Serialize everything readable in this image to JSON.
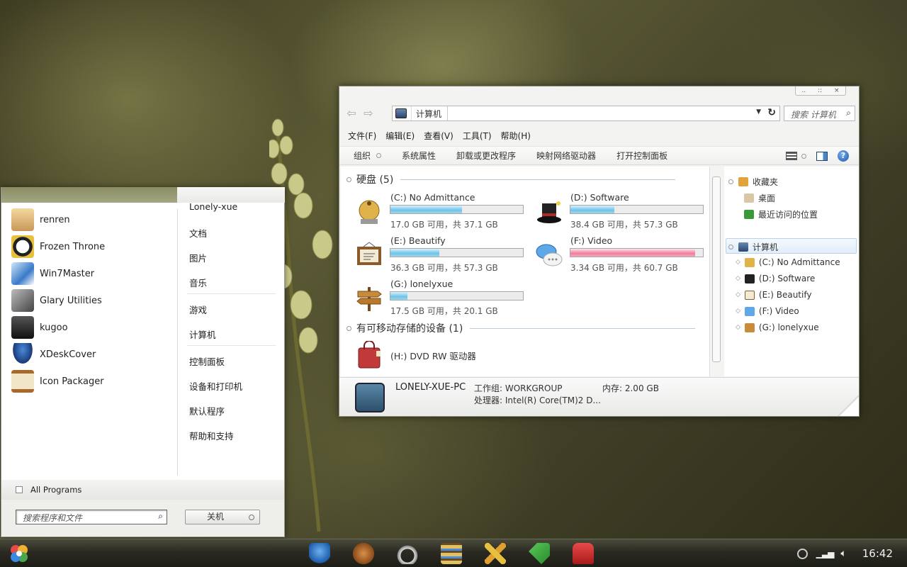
{
  "explorer": {
    "caption_buttons": [
      "..",
      "::",
      "×"
    ],
    "breadcrumb": "计算机",
    "search_placeholder": "搜索 计算机",
    "menu": [
      "文件(F)",
      "编辑(E)",
      "查看(V)",
      "工具(T)",
      "帮助(H)"
    ],
    "commands": [
      "组织",
      "系统属性",
      "卸载或更改程序",
      "映射网络驱动器",
      "打开控制面板"
    ],
    "groups": {
      "hard_disks": "硬盘 (5)",
      "removable": "有可移动存储的设备 (1)"
    },
    "drives": [
      {
        "name": "(C:) No Admittance",
        "free": "17.0 GB 可用，共 37.1 GB",
        "used_fraction": 0.54,
        "color": "#6ec3e8"
      },
      {
        "name": "(D:) Software",
        "free": "38.4 GB 可用，共 57.3 GB",
        "used_fraction": 0.33,
        "color": "#6ec3e8"
      },
      {
        "name": "(E:) Beautify",
        "free": "36.3 GB 可用，共 57.3 GB",
        "used_fraction": 0.37,
        "color": "#6ec3e8"
      },
      {
        "name": "(F:) Video",
        "free": "3.34 GB 可用，共 60.7 GB",
        "used_fraction": 0.94,
        "color": "#ee7f9d"
      },
      {
        "name": "(G:) lonelyxue",
        "free": "17.5 GB 可用，共 20.1 GB",
        "used_fraction": 0.13,
        "color": "#6ec3e8"
      }
    ],
    "dvd": "(H:) DVD RW 驱动器",
    "nav": {
      "favorites": "收藏夹",
      "desktop": "桌面",
      "recent": "最近访问的位置",
      "computer": "计算机",
      "drives": [
        "(C:) No Admittance",
        "(D:) Software",
        "(E:) Beautify",
        "(F:) Video",
        "(G:) lonelyxue"
      ]
    },
    "details": {
      "pc_name": "LONELY-XUE-PC",
      "workgroup": "工作组: WORKGROUP",
      "memory": "内存: 2.00 GB",
      "cpu": "处理器: Intel(R) Core(TM)2 D..."
    }
  },
  "start_menu": {
    "programs": [
      "renren",
      "Frozen Throne",
      "Win7Master",
      "Glary Utilities",
      "kugoo",
      "XDeskCover",
      "Icon Packager"
    ],
    "places": [
      "Lonely-xue",
      "文档",
      "图片",
      "音乐",
      "游戏",
      "计算机",
      "控制面板",
      "设备和打印机",
      "默认程序",
      "帮助和支持"
    ],
    "all_programs": "All Programs",
    "search_placeholder": "搜索程序和文件",
    "shutdown": "关机"
  },
  "taskbar": {
    "pinned_icons": [
      "bird-icon",
      "teddy-bear-icon",
      "headphones-icon",
      "bookshelf-icon",
      "pencil-ruler-icon",
      "tag-icon",
      "sofa-icon"
    ],
    "clock": "16:42"
  }
}
